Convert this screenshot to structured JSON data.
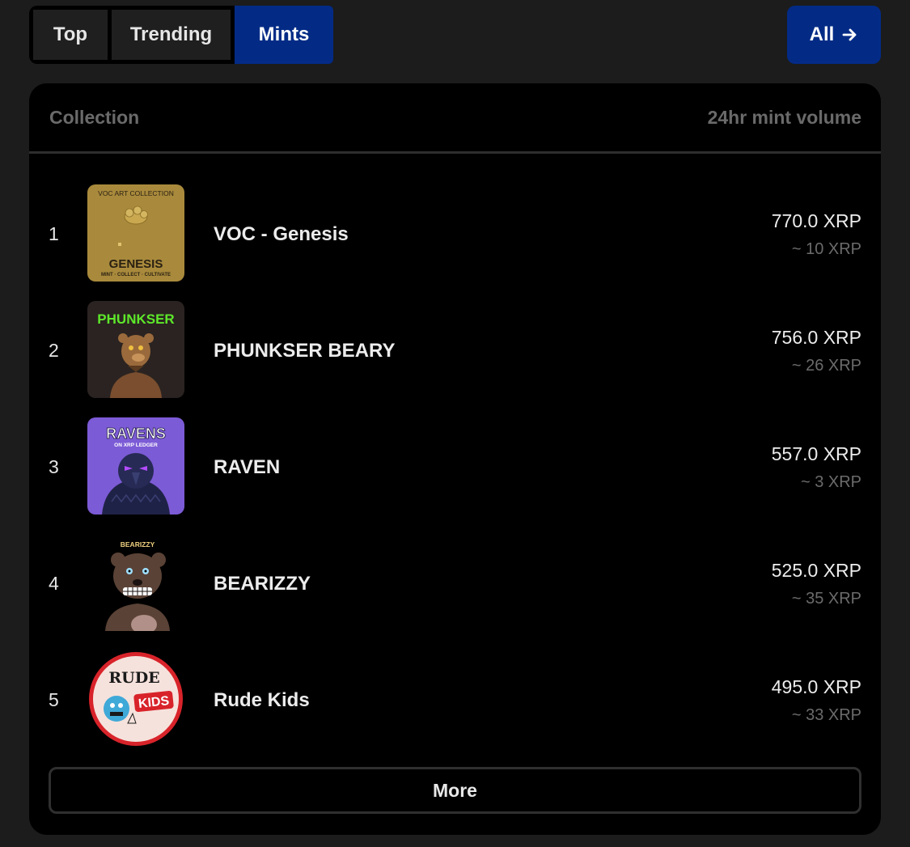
{
  "tabs": [
    {
      "label": "Top",
      "active": false
    },
    {
      "label": "Trending",
      "active": false
    },
    {
      "label": "Mints",
      "active": true
    }
  ],
  "all_button": {
    "label": "All",
    "icon": "arrow-right-icon"
  },
  "colors": {
    "accent": "#032b86",
    "panel": "#000000",
    "background": "#1c1c1c",
    "muted": "#6b6b6b"
  },
  "table": {
    "header_collection": "Collection",
    "header_volume": "24hr mint volume"
  },
  "rows": [
    {
      "rank": "1",
      "name": "VOC - Genesis",
      "volume": "770.0 XRP",
      "floor": "~ 10 XRP",
      "thumb_text": {
        "top": "VOC ART COLLECTION",
        "title": "GENESIS",
        "bottom": "MINT · COLLECT · CULTIVATE"
      }
    },
    {
      "rank": "2",
      "name": "PHUNKSER BEARY",
      "volume": "756.0 XRP",
      "floor": "~ 26 XRP",
      "thumb_text": {
        "title": "PHUNKSER"
      }
    },
    {
      "rank": "3",
      "name": "RAVEN",
      "volume": "557.0 XRP",
      "floor": "~ 3 XRP",
      "thumb_text": {
        "title": "RAVENS",
        "sub": "ON XRP LEDGER"
      }
    },
    {
      "rank": "4",
      "name": "BEARIZZY",
      "volume": "525.0 XRP",
      "floor": "~ 35 XRP",
      "thumb_text": {
        "title": "BEARIZZY"
      }
    },
    {
      "rank": "5",
      "name": "Rude Kids",
      "volume": "495.0 XRP",
      "floor": "~ 33 XRP",
      "thumb_text": {
        "title": "RUDE",
        "sub": "KIDS"
      }
    }
  ],
  "more_button": {
    "label": "More"
  }
}
